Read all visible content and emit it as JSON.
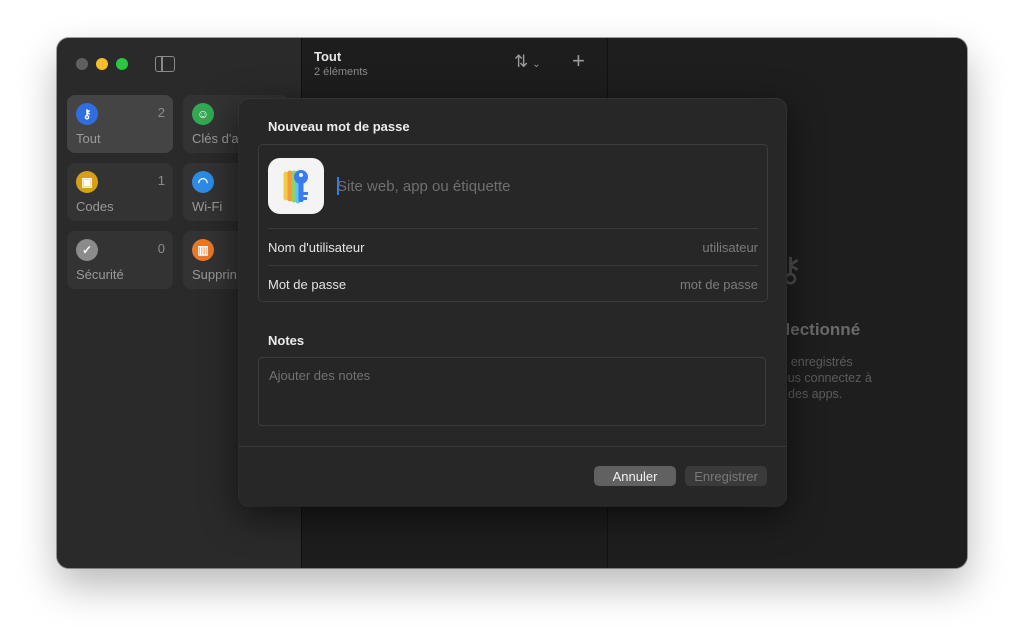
{
  "window": {
    "sidebar": {
      "tiles": [
        {
          "label": "Tout",
          "count": "2",
          "icon": "key-icon",
          "color": "#2f6de0"
        },
        {
          "label": "Clés d'a",
          "count": "",
          "icon": "person-key-icon",
          "color": "#34a853"
        },
        {
          "label": "Codes",
          "count": "1",
          "icon": "lock-icon",
          "color": "#d4a017"
        },
        {
          "label": "Wi-Fi",
          "count": "",
          "icon": "wifi-icon",
          "color": "#2c8ce6"
        },
        {
          "label": "Sécurité",
          "count": "0",
          "icon": "checkmark-icon",
          "color": "#8b8b8b"
        },
        {
          "label": "Supprin",
          "count": "",
          "icon": "trash-icon",
          "color": "#e8792a"
        }
      ]
    },
    "list": {
      "title": "Tout",
      "subtitle": "2 éléments"
    },
    "detail": {
      "empty_title": "nt sélectionné",
      "empty_desc_1": "e sont enregistrés",
      "empty_desc_2": "e vous vous connectez à",
      "empty_desc_3": "et à des apps."
    }
  },
  "dialog": {
    "title": "Nouveau mot de passe",
    "site_placeholder": "Site web, app ou étiquette",
    "username_label": "Nom d'utilisateur",
    "username_placeholder": "utilisateur",
    "password_label": "Mot de passe",
    "password_placeholder": "mot de passe",
    "notes_label": "Notes",
    "notes_placeholder": "Ajouter des notes",
    "cancel_label": "Annuler",
    "save_label": "Enregistrer"
  },
  "colors": {
    "accent": "#2d7ff9"
  }
}
